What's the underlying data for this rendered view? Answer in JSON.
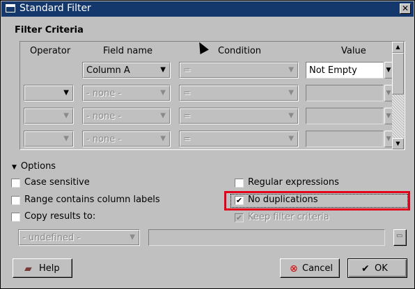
{
  "window": {
    "title": "Standard Filter",
    "close_glyph": "✕"
  },
  "filter_criteria": {
    "title": "Filter Criteria",
    "columns": [
      "Operator",
      "Field name",
      "Condition",
      "Value"
    ],
    "rows": [
      {
        "operator": "",
        "field": "Column A",
        "condition": "=",
        "value": "Not Empty"
      },
      {
        "operator": "",
        "field": "- none -",
        "condition": "=",
        "value": ""
      },
      {
        "operator": "",
        "field": "- none -",
        "condition": "=",
        "value": ""
      },
      {
        "operator": "",
        "field": "- none -",
        "condition": "=",
        "value": ""
      }
    ]
  },
  "options": {
    "label": "Options",
    "case_sensitive": {
      "label": "Case sensitive",
      "checked": false
    },
    "range_labels": {
      "label": "Range contains column labels",
      "checked": false
    },
    "copy_results": {
      "label": "Copy results to:",
      "checked": false
    },
    "regex": {
      "label": "Regular expressions",
      "checked": false
    },
    "no_duplications": {
      "label": "No duplications",
      "checked": true
    },
    "keep_criteria": {
      "label": "Keep filter criteria",
      "checked": true
    },
    "copy_target": {
      "value": "- undefined -"
    }
  },
  "buttons": {
    "help": "Help",
    "cancel": "Cancel",
    "ok": "OK"
  },
  "glyphs": {
    "arrow": "▼",
    "check": "✔",
    "up": "▲",
    "down": "▼",
    "triangle": "▼"
  },
  "colors": {
    "titlebar": "#14386b",
    "highlight": "#e2001a"
  }
}
